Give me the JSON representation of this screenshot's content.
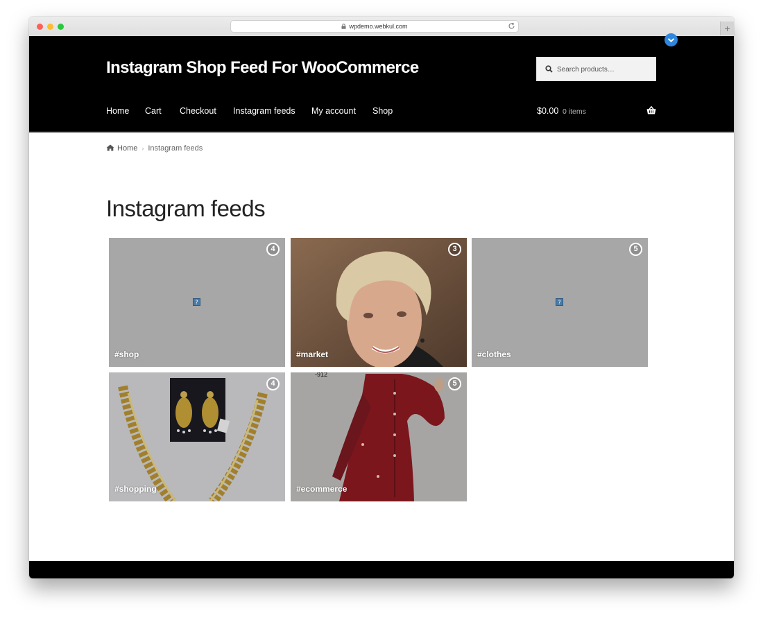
{
  "browser": {
    "url": "wpdemo.webkul.com"
  },
  "site": {
    "title": "Instagram Shop Feed For WooCommerce"
  },
  "search": {
    "placeholder": "Search products…"
  },
  "nav": {
    "items": [
      {
        "label": "Home"
      },
      {
        "label": "Cart"
      },
      {
        "label": "Checkout"
      },
      {
        "label": "Instagram feeds"
      },
      {
        "label": "My account"
      },
      {
        "label": "Shop"
      }
    ]
  },
  "cart": {
    "total": "$0.00",
    "count": "0 items"
  },
  "breadcrumb": {
    "home": "Home",
    "current": "Instagram feeds"
  },
  "page": {
    "title": "Instagram feeds"
  },
  "feeds": [
    {
      "tag": "#shop",
      "count": "4",
      "image": "broken-image-icon"
    },
    {
      "tag": "#market",
      "count": "3",
      "image": "portrait-woman"
    },
    {
      "tag": "#clothes",
      "count": "5",
      "image": "broken-image-icon"
    },
    {
      "tag": "#shopping",
      "count": "4",
      "image": "gold-earrings-necklace"
    },
    {
      "tag": "#ecommerce",
      "count": "5",
      "image": "red-kurta",
      "image_text": "-912"
    }
  ],
  "colors": {
    "header_bg": "#000000",
    "accent": "#2e86de",
    "tile_bg": "#a7a7a7"
  }
}
